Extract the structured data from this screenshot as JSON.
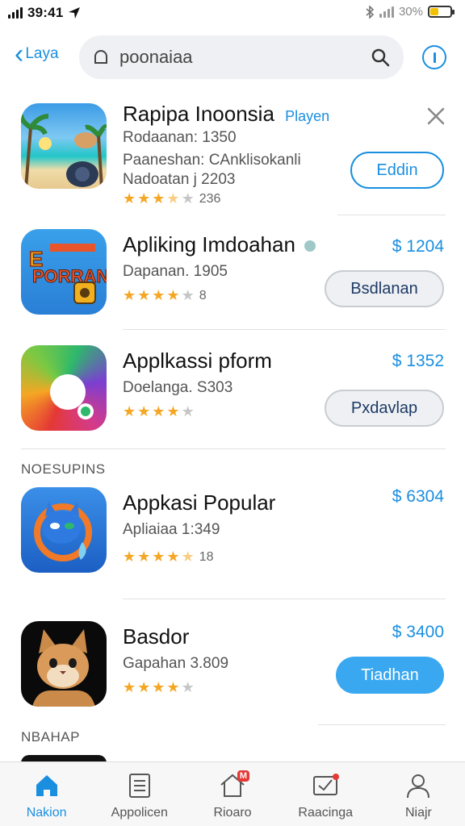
{
  "status_bar": {
    "time": "39:41",
    "battery": "30%"
  },
  "nav": {
    "back_label": "Laya",
    "search_value": "poonaiaa"
  },
  "apps": [
    {
      "title": "Rapipa Inoonsia",
      "tag": "Playen",
      "line1": "Rodaanan: 1350",
      "line2": "Paaneshan: CAnklisokanli",
      "line3": "Nadoatan j 2203",
      "rating": 3.5,
      "rating_count": "236",
      "button": "Eddin"
    },
    {
      "title": "Apliking Imdoahan",
      "line1": "Dapanan. 1905",
      "rating": 4,
      "rating_count": "8",
      "price": "$ 1204",
      "button": "Bsdlanan"
    },
    {
      "title": "Applkassi pform",
      "line1": "Doelanga. S303",
      "rating": 4,
      "rating_count": "",
      "price": "$ 1352",
      "button": "Pxdavlap"
    },
    {
      "title": "Appkasi Popular",
      "line1": "Apliaiaa 1:349",
      "rating": 4.5,
      "rating_count": "18",
      "price": "$ 6304"
    },
    {
      "title": "Basdor",
      "line1": "Gapahan 3.809",
      "rating": 4,
      "rating_count": "",
      "price": "$ 3400",
      "button": "Tiadhan"
    }
  ],
  "section_labels": [
    "NOESUPINS",
    "NBAHAP"
  ],
  "tabs": [
    {
      "label": "Nakion",
      "icon": "home-icon"
    },
    {
      "label": "Appolicen",
      "icon": "document-icon"
    },
    {
      "label": "Rioaro",
      "icon": "house-badge-icon",
      "badge": "M"
    },
    {
      "label": "Raacinga",
      "icon": "inbox-icon"
    },
    {
      "label": "Niajr",
      "icon": "person-icon"
    }
  ],
  "colors": {
    "accent": "#1a8fe0",
    "star": "#f5a623",
    "solid_button": "#3aa8f0"
  }
}
